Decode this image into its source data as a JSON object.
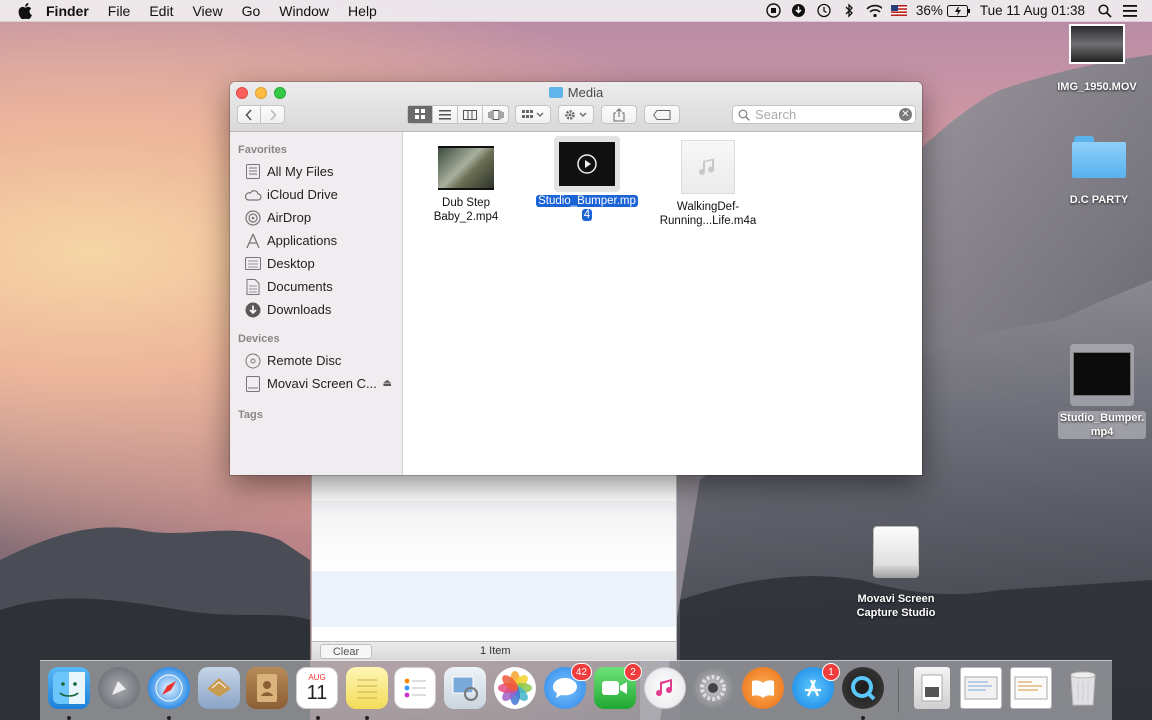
{
  "menubar": {
    "app_name": "Finder",
    "items": [
      "File",
      "Edit",
      "View",
      "Go",
      "Window",
      "Help"
    ],
    "battery": "36%",
    "clock": "Tue 11 Aug  01:38"
  },
  "finder": {
    "title": "Media",
    "search_placeholder": "Search",
    "sidebar": {
      "favorites_header": "Favorites",
      "favorites": [
        "All My Files",
        "iCloud Drive",
        "AirDrop",
        "Applications",
        "Desktop",
        "Documents",
        "Downloads"
      ],
      "devices_header": "Devices",
      "devices": [
        "Remote Disc",
        "Movavi Screen C..."
      ],
      "tags_header": "Tags"
    },
    "files": [
      {
        "name_line1": "Dub Step",
        "name_line2": "Baby_2.mp4"
      },
      {
        "name_line1": "Studio_Bumper.mp",
        "name_line2": "4",
        "selected": true
      },
      {
        "name_line1": "WalkingDef-",
        "name_line2": "Running...Life.m4a"
      }
    ]
  },
  "bg_window": {
    "clear_label": "Clear",
    "count_label": "1 Item"
  },
  "desktop": {
    "icons": [
      {
        "line1": "IMG_1950.MOV",
        "line2": ""
      },
      {
        "line1": "D.C PARTY",
        "line2": ""
      },
      {
        "line1": "Studio_Bumper.",
        "line2": "mp4"
      },
      {
        "line1": "Movavi Screen",
        "line2": "Capture Studio"
      }
    ]
  },
  "dock": {
    "calendar_month": "AUG",
    "calendar_day": "11",
    "messages_badge": "42",
    "facetime_badge": "2",
    "appstore_badge": "1"
  }
}
